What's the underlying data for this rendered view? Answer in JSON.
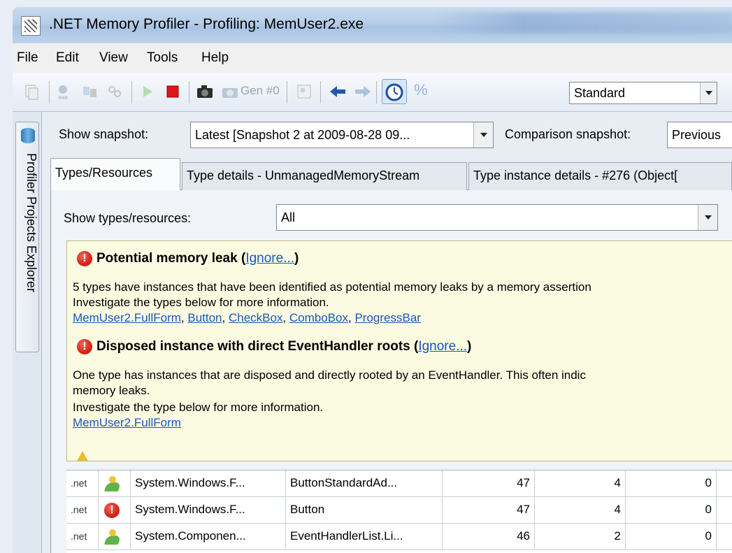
{
  "window": {
    "title": ".NET Memory Profiler - Profiling: MemUser2.exe"
  },
  "menu": {
    "items": [
      {
        "label": "File"
      },
      {
        "label": "Edit"
      },
      {
        "label": "View"
      },
      {
        "label": "Tools"
      },
      {
        "label": "Help"
      }
    ]
  },
  "toolbar": {
    "gen_label": "Gen #0",
    "percent_label": "%",
    "view_mode": "Standard",
    "icons": [
      "copy-icon",
      "exe-icon",
      "compare-icon",
      "link-icon",
      "play-icon",
      "stop-icon",
      "camera-icon",
      "gen-snapshot-icon",
      "export-icon",
      "back-arrow-icon",
      "forward-arrow-icon",
      "timer-icon"
    ]
  },
  "sidebar": {
    "tab_label": "Profiler Projects Explorer"
  },
  "snapshot": {
    "show_label": "Show snapshot:",
    "show_value": "Latest [Snapshot 2 at 2009-08-28 09...",
    "comparison_label": "Comparison snapshot:",
    "comparison_value": "Previous"
  },
  "tabs": [
    {
      "label": "Types/Resources",
      "active": true
    },
    {
      "label": "Type details - UnmanagedMemoryStream",
      "active": false
    },
    {
      "label": "Type instance details - #276 (Object[",
      "active": false
    }
  ],
  "filter": {
    "label": "Show types/resources:",
    "value": "All"
  },
  "info": {
    "leak_title": "Potential memory leak",
    "leak_ignore": "Ignore...",
    "leak_line1": "5 types have instances that have been identified as potential memory leaks by a memory assertion",
    "leak_line2": "Investigate the types below for more information.",
    "leak_links": [
      "MemUser2.FullForm",
      "Button",
      "CheckBox",
      "ComboBox",
      "ProgressBar"
    ],
    "disposed_title": "Disposed instance with direct EventHandler roots",
    "disposed_ignore": "Ignore...",
    "disposed_line1": "One type has instances that are disposed and directly rooted by an EventHandler. This often indic",
    "disposed_line2": "memory leaks.",
    "disposed_line3": "Investigate the type below for more information.",
    "disposed_link": "MemUser2.FullForm"
  },
  "grid": {
    "rows": [
      {
        "kind": ".net",
        "status": "ok",
        "namespace": "System.Windows.F...",
        "name": "ButtonStandardAd...",
        "c1": "47",
        "c2": "4",
        "c3": "0"
      },
      {
        "kind": ".net",
        "status": "error",
        "namespace": "System.Windows.F...",
        "name": "Button",
        "c1": "47",
        "c2": "4",
        "c3": "0"
      },
      {
        "kind": ".net",
        "status": "ok",
        "namespace": "System.Componen...",
        "name": "EventHandlerList.Li...",
        "c1": "46",
        "c2": "2",
        "c3": "0"
      }
    ]
  },
  "colors": {
    "link": "#1a56b8",
    "info_bg": "#fbfbe2",
    "error": "#d7281a"
  }
}
